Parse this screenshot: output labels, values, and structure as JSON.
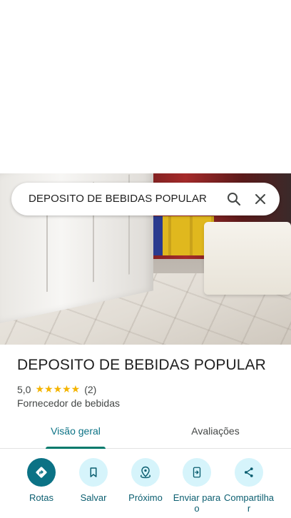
{
  "search": {
    "query": "DEPOSITO DE BEBIDAS POPULAR",
    "search_icon": "search-icon",
    "close_icon": "close-icon"
  },
  "place": {
    "name": "DEPOSITO DE BEBIDAS POPULAR",
    "rating": "5,0",
    "stars": "★★★★★",
    "star_count": 5,
    "review_count": "(2)",
    "category": "Fornecedor de bebidas"
  },
  "tabs": [
    {
      "label": "Visão geral",
      "active": true
    },
    {
      "label": "Avaliações",
      "active": false
    }
  ],
  "actions": [
    {
      "label": "Rotas",
      "icon": "directions-icon"
    },
    {
      "label": "Salvar",
      "icon": "bookmark-icon"
    },
    {
      "label": "Próximo",
      "icon": "nearby-icon"
    },
    {
      "label": "Enviar para o",
      "icon": "send-to-phone-icon"
    },
    {
      "label": "Compartilhar",
      "icon": "share-icon"
    }
  ],
  "colors": {
    "accent": "#0b7285",
    "accent_light": "#d6f4fb",
    "star": "#f4b400",
    "tab_indicator": "#00796b"
  }
}
